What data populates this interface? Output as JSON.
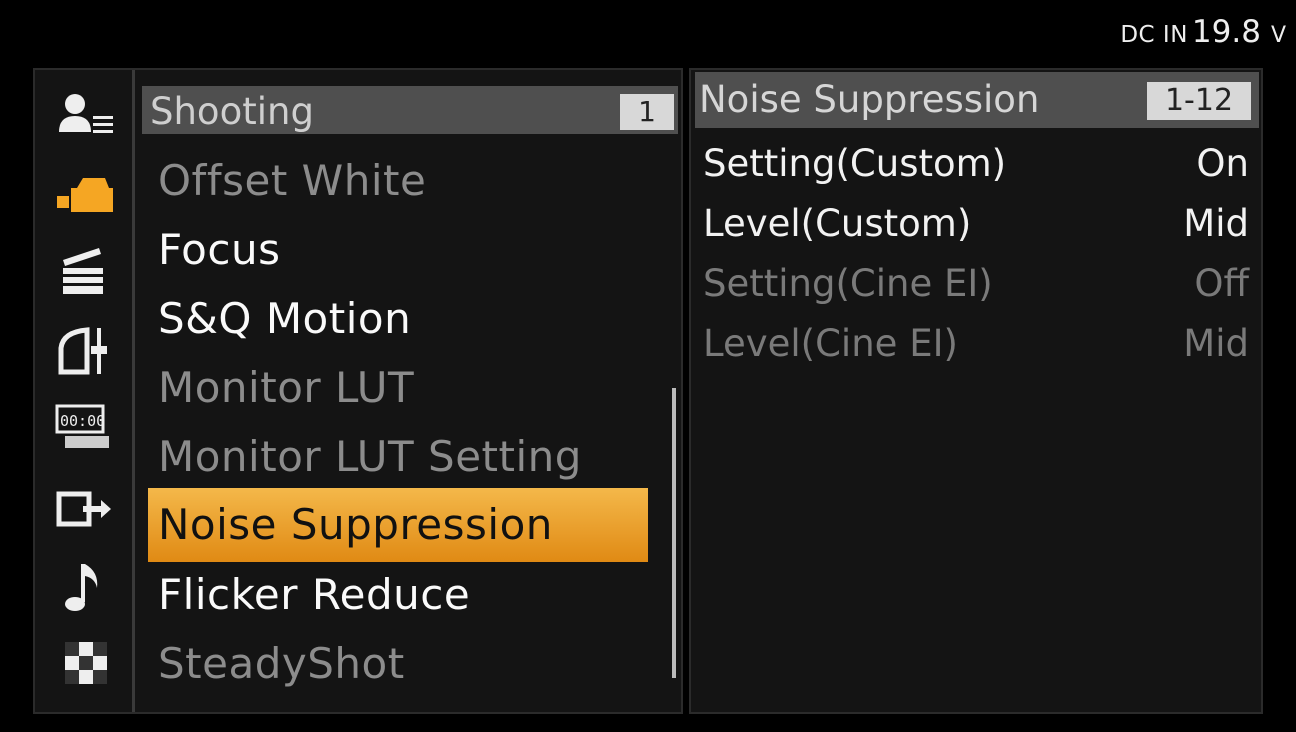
{
  "status": {
    "power_source": "DC IN",
    "voltage": "19.8",
    "unit": "V"
  },
  "sidebar": {
    "icons": [
      {
        "name": "user-menu-icon",
        "selected": false
      },
      {
        "name": "camera-shooting-icon",
        "selected": true
      },
      {
        "name": "clapperboard-icon",
        "selected": false
      },
      {
        "name": "paint-adjust-icon",
        "selected": false
      },
      {
        "name": "timecode-icon",
        "selected": false
      },
      {
        "name": "output-icon",
        "selected": false
      },
      {
        "name": "audio-note-icon",
        "selected": false
      },
      {
        "name": "checker-pattern-icon",
        "selected": false
      }
    ],
    "accent_color": "#f5a623"
  },
  "menu": {
    "title": "Shooting",
    "page": "1",
    "items": [
      {
        "label": "Offset White",
        "state": "dim"
      },
      {
        "label": "Focus",
        "state": "active"
      },
      {
        "label": "S&Q Motion",
        "state": "active"
      },
      {
        "label": "Monitor LUT",
        "state": "dim"
      },
      {
        "label": "Monitor LUT Setting",
        "state": "dim"
      },
      {
        "label": "Noise Suppression",
        "state": "selected"
      },
      {
        "label": "Flicker Reduce",
        "state": "active"
      },
      {
        "label": "SteadyShot",
        "state": "dim"
      }
    ],
    "selected_color": "#f0a030"
  },
  "detail": {
    "title": "Noise Suppression",
    "range": "1-12",
    "rows": [
      {
        "label": "Setting(Custom)",
        "value": "On",
        "state": "active"
      },
      {
        "label": "Level(Custom)",
        "value": "Mid",
        "state": "active"
      },
      {
        "label": "Setting(Cine EI)",
        "value": "Off",
        "state": "dim"
      },
      {
        "label": "Level(Cine EI)",
        "value": "Mid",
        "state": "dim"
      }
    ]
  }
}
